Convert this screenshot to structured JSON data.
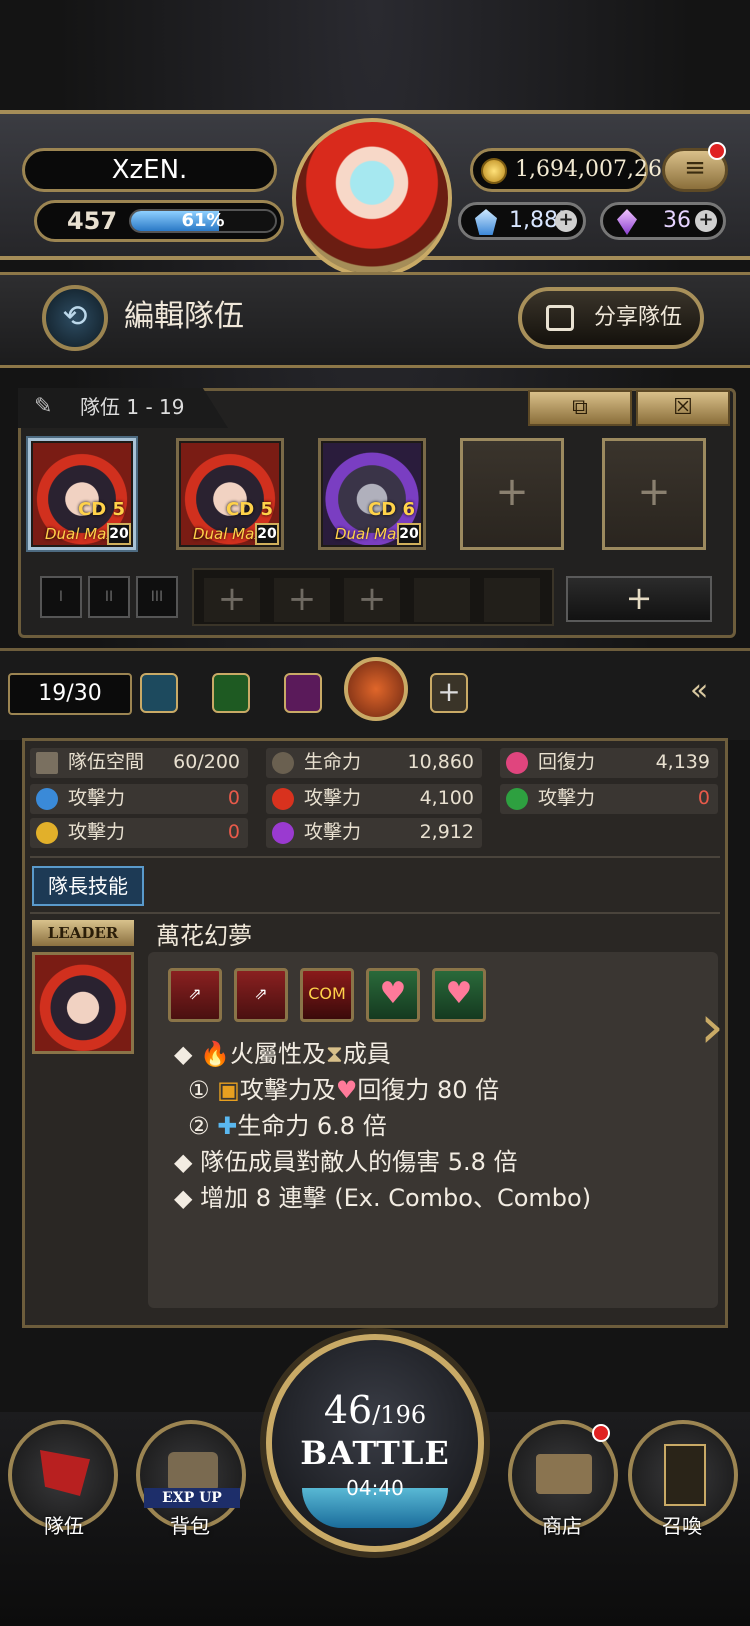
{
  "player": {
    "name": "XzEN.",
    "level": "457",
    "exp_percent": "61%",
    "exp_fraction": 0.61
  },
  "currency": {
    "coins": "1,694,007,261",
    "diamonds": "1,885",
    "crystals": "36"
  },
  "header": {
    "title": "編輯隊伍",
    "share_label": "分享隊伍"
  },
  "team": {
    "tab_label": "隊伍 1 - 19",
    "members": [
      {
        "cd": "CD 5",
        "badge": "Dual Max",
        "level": "20"
      },
      {
        "cd": "CD 5",
        "badge": "Dual Max",
        "level": "20"
      },
      {
        "cd": "CD 6",
        "badge": "Dual Max",
        "level": "20"
      }
    ],
    "add_label": "+"
  },
  "filter": {
    "count": "19/30"
  },
  "stats": {
    "space": {
      "label": "隊伍空間",
      "value": "60/200"
    },
    "hp": {
      "label": "生命力",
      "value": "10,860"
    },
    "recovery": {
      "label": "回復力",
      "value": "4,139"
    },
    "atk_water": {
      "label": "攻擊力",
      "value": "0"
    },
    "atk_fire": {
      "label": "攻擊力",
      "value": "4,100"
    },
    "atk_wood": {
      "label": "攻擊力",
      "value": "0"
    },
    "atk_light": {
      "label": "攻擊力",
      "value": "0"
    },
    "atk_dark": {
      "label": "攻擊力",
      "value": "2,912"
    }
  },
  "leader": {
    "tab": "隊長技能",
    "badge": "LEADER",
    "skill_name": "萬花幻夢",
    "icons": [
      "COM"
    ],
    "lines": {
      "l1": "火屬性及",
      "l1b": "成員",
      "l2": "攻擊力及",
      "l2b": "回復力 80 倍",
      "l3": "生命力 6.8 倍",
      "l4": "隊伍成員對敵人的傷害 5.8 倍",
      "l5": "增加 8 連擊 (Ex. Combo、Combo)",
      "n1": "①",
      "n2": "②"
    }
  },
  "battle": {
    "stamina_cur": "46",
    "stamina_max": "/196",
    "label": "BATTLE",
    "timer": "04:40"
  },
  "nav": {
    "team": "隊伍",
    "bag": "背包",
    "bag_badge": "EXP UP",
    "shop": "商店",
    "summon": "召喚"
  }
}
